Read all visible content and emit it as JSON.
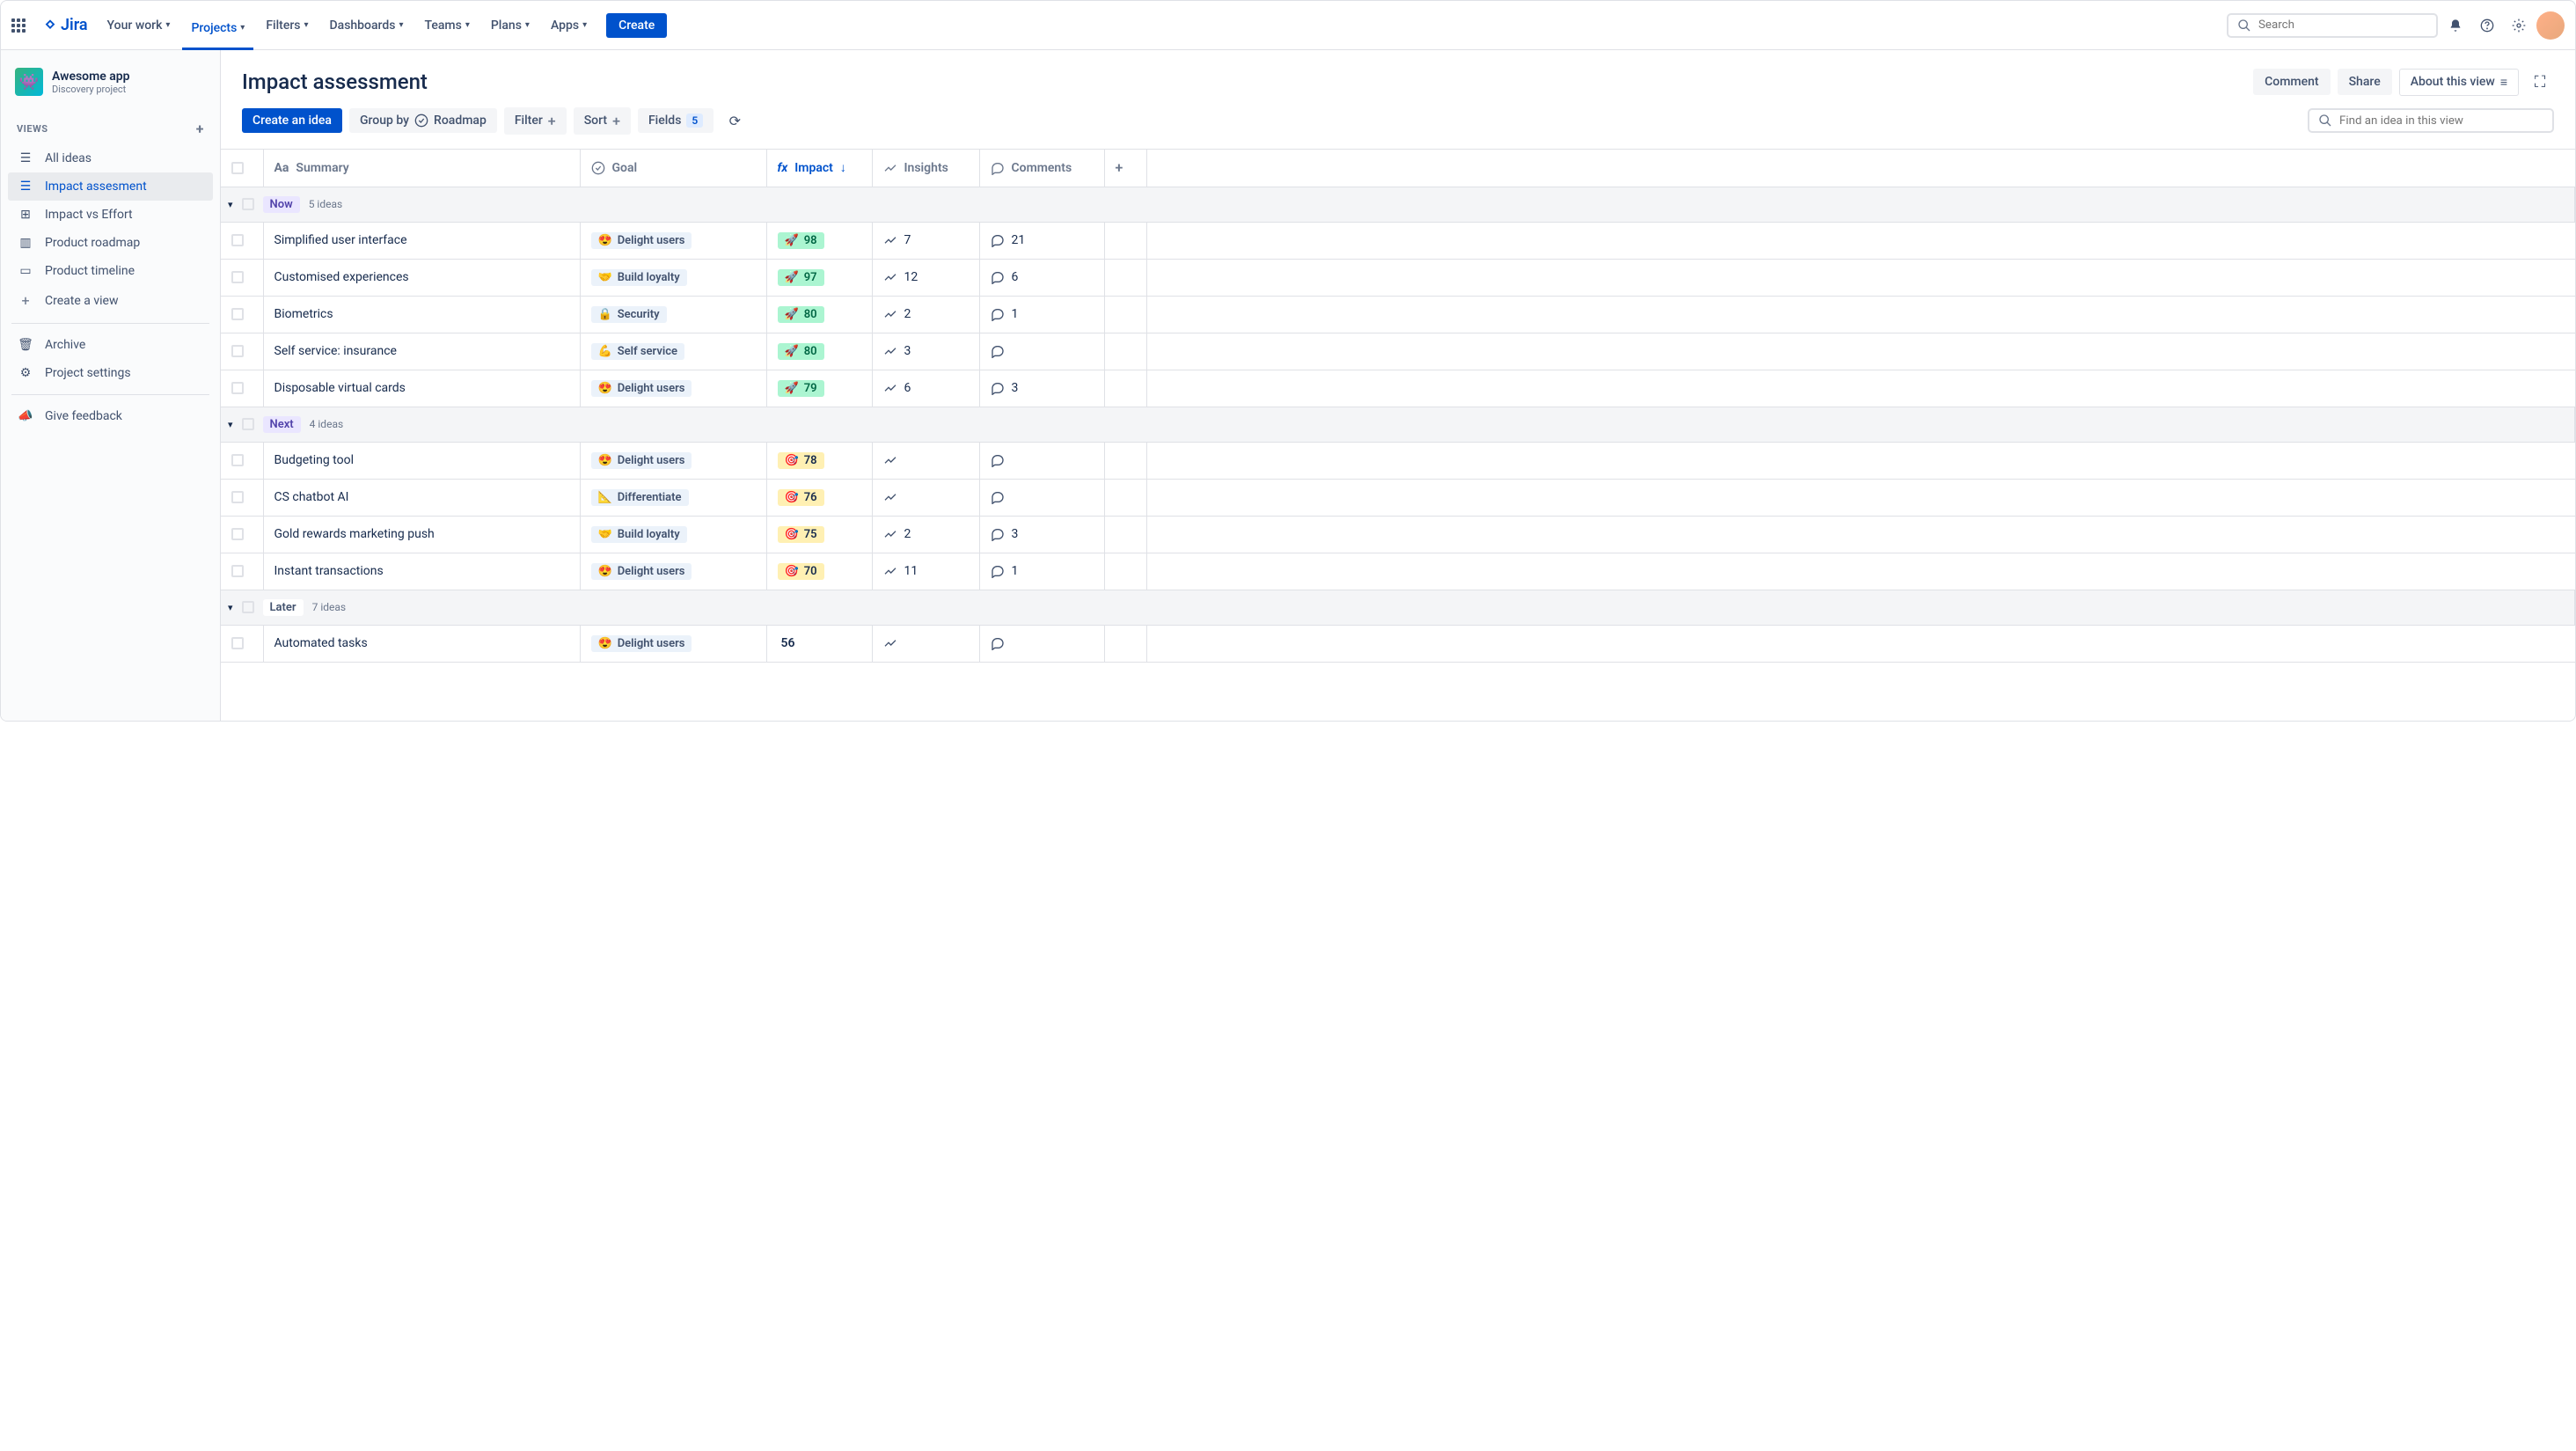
{
  "brand": "Jira",
  "nav": {
    "your_work": "Your work",
    "projects": "Projects",
    "filters": "Filters",
    "dashboards": "Dashboards",
    "teams": "Teams",
    "plans": "Plans",
    "apps": "Apps",
    "create": "Create",
    "search_placeholder": "Search"
  },
  "sidebar": {
    "project_name": "Awesome app",
    "project_type": "Discovery project",
    "views_label": "VIEWS",
    "items": [
      {
        "label": "All ideas"
      },
      {
        "label": "Impact assesment"
      },
      {
        "label": "Impact vs Effort"
      },
      {
        "label": "Product roadmap"
      },
      {
        "label": "Product timeline"
      },
      {
        "label": "Create a view"
      }
    ],
    "archive": "Archive",
    "settings": "Project settings",
    "feedback": "Give feedback"
  },
  "header": {
    "title": "Impact assessment",
    "comment": "Comment",
    "share": "Share",
    "about": "About this view"
  },
  "toolbar": {
    "create_idea": "Create an idea",
    "group_by": "Group by",
    "group_by_value": "Roadmap",
    "filter": "Filter",
    "sort": "Sort",
    "fields": "Fields",
    "fields_count": "5",
    "find_placeholder": "Find an idea in this view"
  },
  "columns": {
    "summary": "Summary",
    "goal": "Goal",
    "impact": "Impact",
    "insights": "Insights",
    "comments": "Comments"
  },
  "goals": {
    "delight": {
      "emoji": "😍",
      "label": "Delight users"
    },
    "loyalty": {
      "emoji": "🤝",
      "label": "Build loyalty"
    },
    "security": {
      "emoji": "🔒",
      "label": "Security"
    },
    "self": {
      "emoji": "💪",
      "label": "Self service"
    },
    "diff": {
      "emoji": "📐",
      "label": "Differentiate"
    }
  },
  "groups": [
    {
      "name": "Now",
      "tag_class": "tag-now",
      "count": "5 ideas",
      "rows": [
        {
          "summary": "Simplified user interface",
          "goal": "delight",
          "impact": "98",
          "impact_style": "green",
          "impact_emoji": "🚀",
          "insights": "7",
          "comments": "21"
        },
        {
          "summary": "Customised experiences",
          "goal": "loyalty",
          "impact": "97",
          "impact_style": "green",
          "impact_emoji": "🚀",
          "insights": "12",
          "comments": "6"
        },
        {
          "summary": "Biometrics",
          "goal": "security",
          "impact": "80",
          "impact_style": "green",
          "impact_emoji": "🚀",
          "insights": "2",
          "comments": "1"
        },
        {
          "summary": "Self service: insurance",
          "goal": "self",
          "impact": "80",
          "impact_style": "green",
          "impact_emoji": "🚀",
          "insights": "3",
          "comments": ""
        },
        {
          "summary": "Disposable virtual cards",
          "goal": "delight",
          "impact": "79",
          "impact_style": "green",
          "impact_emoji": "🚀",
          "insights": "6",
          "comments": "3"
        }
      ]
    },
    {
      "name": "Next",
      "tag_class": "tag-next",
      "count": "4 ideas",
      "rows": [
        {
          "summary": "Budgeting tool",
          "goal": "delight",
          "impact": "78",
          "impact_style": "yellow",
          "impact_emoji": "🎯",
          "insights": "",
          "comments": ""
        },
        {
          "summary": "CS chatbot AI",
          "goal": "diff",
          "impact": "76",
          "impact_style": "yellow",
          "impact_emoji": "🎯",
          "insights": "",
          "comments": ""
        },
        {
          "summary": "Gold rewards marketing push",
          "goal": "loyalty",
          "impact": "75",
          "impact_style": "yellow",
          "impact_emoji": "🎯",
          "insights": "2",
          "comments": "3"
        },
        {
          "summary": "Instant transactions",
          "goal": "delight",
          "impact": "70",
          "impact_style": "yellow",
          "impact_emoji": "🎯",
          "insights": "11",
          "comments": "1"
        }
      ]
    },
    {
      "name": "Later",
      "tag_class": "tag-later",
      "count": "7 ideas",
      "rows": [
        {
          "summary": "Automated tasks",
          "goal": "delight",
          "impact": "56",
          "impact_style": "plain",
          "impact_emoji": "",
          "insights": "",
          "comments": ""
        }
      ]
    }
  ]
}
